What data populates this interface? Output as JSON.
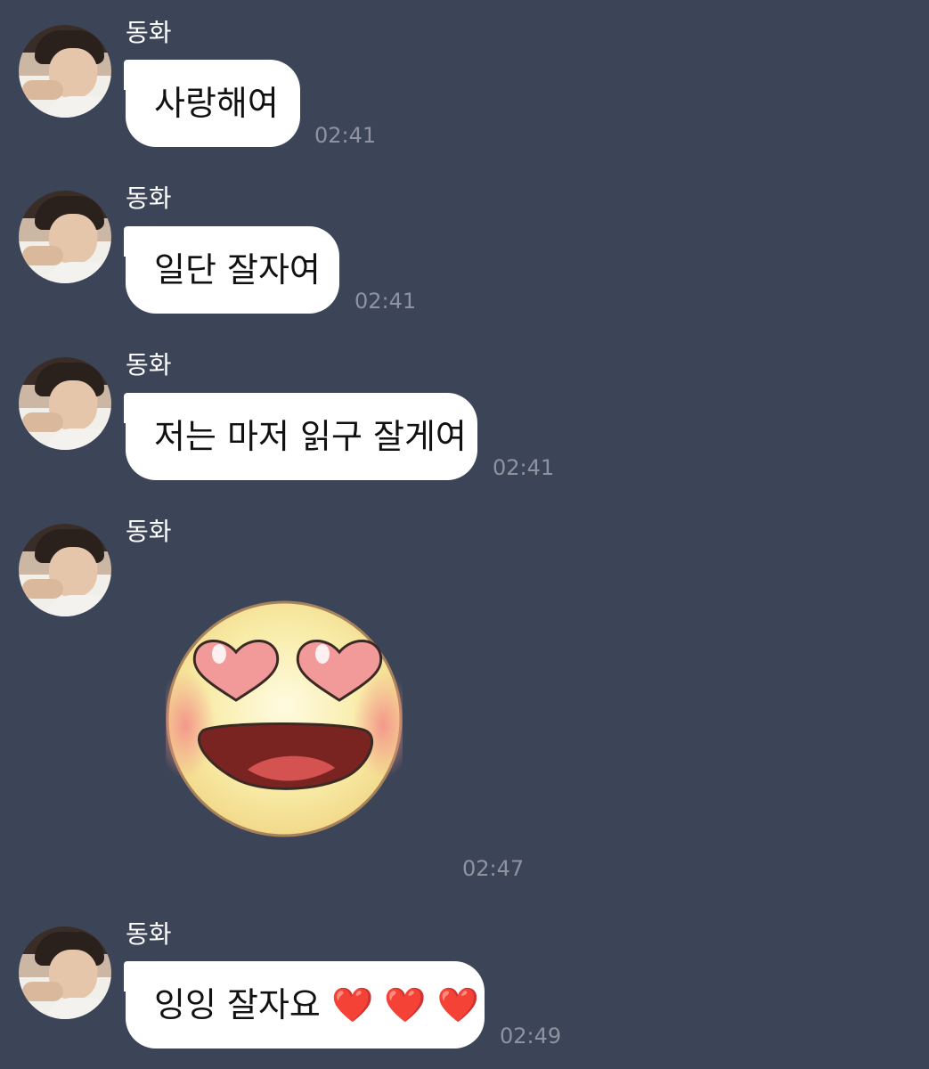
{
  "messages": [
    {
      "sender": "동화",
      "text": "사랑해여",
      "time": "02:41"
    },
    {
      "sender": "동화",
      "text": "일단 잘자여",
      "time": "02:41"
    },
    {
      "sender": "동화",
      "text": "저는 마저 읽구 잘게여",
      "time": "02:41"
    },
    {
      "sender": "동화",
      "sticker": "heart-eyes-smiley-sticker",
      "time": "02:47"
    },
    {
      "sender": "동화",
      "text": "잉잉 잘자요",
      "hearts": [
        "❤️",
        "❤️",
        "❤️"
      ],
      "time": "02:49"
    }
  ],
  "colors": {
    "background": "#3c4457",
    "bubble": "#ffffff",
    "timestamp": "#8d93a1",
    "heart": "#e0302e"
  },
  "icons": {
    "avatar": "profile-photo",
    "heart": "red-heart-emoji"
  }
}
